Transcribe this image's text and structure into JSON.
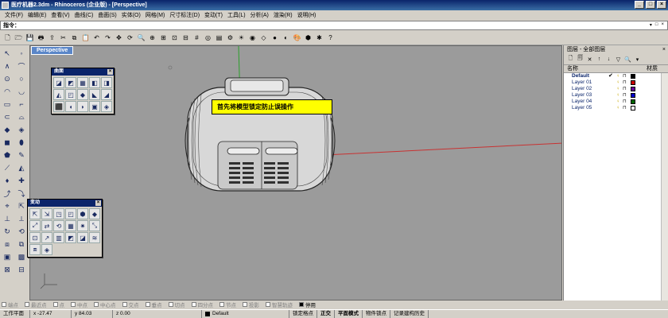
{
  "window": {
    "title": "医疗机器2.3dm - Rhinoceros (企业版) - [Perspective]",
    "min": "_",
    "max": "□",
    "close": "×"
  },
  "menu": [
    "文件(F)",
    "编辑(E)",
    "查看(V)",
    "曲线(C)",
    "曲面(S)",
    "实体(O)",
    "网格(M)",
    "尺寸标注(D)",
    "变动(T)",
    "工具(L)",
    "分析(A)",
    "渲染(R)",
    "说明(H)"
  ],
  "command": {
    "label": "指令：",
    "value": "",
    "right": [
      "▾",
      "□",
      "×"
    ]
  },
  "toolbar_icons": [
    "new-icon",
    "open-icon",
    "save-icon",
    "print-icon",
    "import-icon",
    "cut-icon",
    "copy-icon",
    "paste-icon",
    "undo-icon",
    "redo-icon",
    "pan-icon",
    "rotate-view-icon",
    "zoom-icon",
    "zoom-window-icon",
    "zoom-extents-icon",
    "zoom-selected-icon",
    "four-views-icon",
    "grid-icon",
    "osnap-icon",
    "layer-icon",
    "object-properties-icon",
    "light-icon",
    "render-icon",
    "wireframe-icon",
    "shaded-icon",
    "rendered-icon",
    "color-icon",
    "material-icon",
    "options-icon",
    "help-icon"
  ],
  "toolbar_glyphs": [
    "🗋",
    "🗁",
    "💾",
    "🖶",
    "⇪",
    "✂",
    "⧉",
    "📋",
    "↶",
    "↷",
    "✥",
    "⟳",
    "🔍",
    "⊕",
    "⊞",
    "⊡",
    "⊟",
    "#",
    "◎",
    "▤",
    "⚙",
    "☀",
    "◉",
    "◇",
    "●",
    "◐",
    "🎨",
    "⬢",
    "✱",
    "?"
  ],
  "left_tools": [
    "↖",
    "◦",
    "∧",
    "⌒",
    "⊙",
    "○",
    "◠",
    "◡",
    "▭",
    "⌐",
    "⊂",
    "⌓",
    "◆",
    "◈",
    "◼",
    "⬮",
    "⬟",
    "✎",
    "⟋",
    "◭",
    "♦",
    "✚",
    "⤴",
    "⤵",
    "⌖",
    "⇱",
    "⊥",
    "⟂",
    "↻",
    "⟲",
    "⧈",
    "⧉",
    "▣",
    "▩",
    "⊠",
    "⊟"
  ],
  "viewport": {
    "label": "Perspective",
    "callout": "首先将模型锁定防止误操作"
  },
  "palette_surface": {
    "title": "曲面",
    "icons": [
      "◪",
      "◩",
      "▦",
      "◧",
      "◨",
      "◭",
      "◰",
      "◆",
      "◣",
      "◢",
      "⬛",
      "◖",
      "◗",
      "▣",
      "◈"
    ]
  },
  "palette_transform": {
    "title": "变动",
    "icons": [
      "⇱",
      "⇲",
      "◳",
      "◰",
      "⬢",
      "◆",
      "⤢",
      "⇄",
      "⟲",
      "▦",
      "✷",
      "⤡",
      "⊡",
      "↗",
      "▥",
      "◩",
      "◪",
      "≋",
      "⧈",
      "◈"
    ]
  },
  "layers": {
    "title": "图层 - 全部图层",
    "close": "×",
    "columns": {
      "name": "名称",
      "material": "材质"
    },
    "rows": [
      {
        "name": "Default",
        "current": "✔",
        "color": "#000000"
      },
      {
        "name": "Layer 01",
        "current": "",
        "color": "#cc0000"
      },
      {
        "name": "Layer 02",
        "current": "",
        "color": "#660099"
      },
      {
        "name": "Layer 03",
        "current": "",
        "color": "#0000cc"
      },
      {
        "name": "Layer 04",
        "current": "",
        "color": "#006600"
      },
      {
        "name": "Layer 05",
        "current": "",
        "color": "#ffffff"
      }
    ],
    "tools": [
      "🗋",
      "🗐",
      "✕",
      "↑",
      "↓",
      "▽",
      "🔍",
      "▾"
    ]
  },
  "osnap": [
    {
      "label": "端点",
      "on": false
    },
    {
      "label": "最近点",
      "on": false
    },
    {
      "label": "点",
      "on": false
    },
    {
      "label": "中点",
      "on": false
    },
    {
      "label": "中心点",
      "on": false
    },
    {
      "label": "交点",
      "on": false
    },
    {
      "label": "垂点",
      "on": false
    },
    {
      "label": "切点",
      "on": false
    },
    {
      "label": "四分点",
      "on": false
    },
    {
      "label": "节点",
      "on": false
    },
    {
      "label": "投影",
      "on": false
    },
    {
      "label": "智慧轨迹",
      "on": false
    },
    {
      "label": "停用",
      "on": true
    }
  ],
  "status": {
    "workplane": "工作平面",
    "x": "x -27.47",
    "y": "y 84.03",
    "z": "z 0.00",
    "layer": "Default",
    "items": [
      "锁定格点",
      "正交",
      "平面模式",
      "物件锁点",
      "记录建构历史"
    ]
  }
}
